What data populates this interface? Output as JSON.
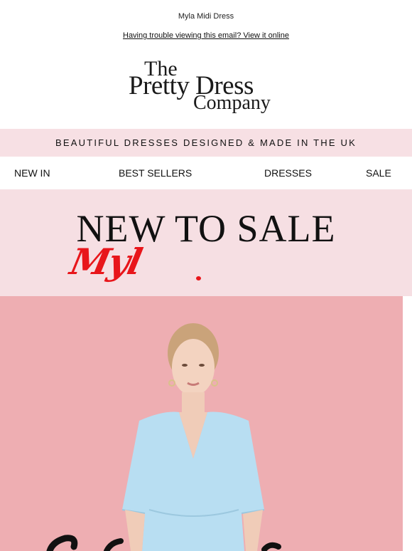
{
  "preheader": "Myla Midi Dress",
  "view_online": "Having trouble viewing this email? View it online",
  "logo": {
    "line1": "The",
    "line2": "Pretty Dress",
    "line3": "Company"
  },
  "banner": "BEAUTIFUL DRESSES DESIGNED & MADE IN THE UK",
  "nav": {
    "new_in": "NEW IN",
    "best_sellers": "BEST SELLERS",
    "dresses": "DRESSES",
    "sale": "SALE"
  },
  "hero": {
    "headline": "NEW TO SALE",
    "script": "Myl"
  },
  "colors": {
    "banner_bg": "#f7e0e4",
    "hero_bg": "#f6dfe3",
    "photo_bg": "#eeaeb2",
    "script_red": "#e8161b",
    "dress_blue": "#b8def2"
  }
}
